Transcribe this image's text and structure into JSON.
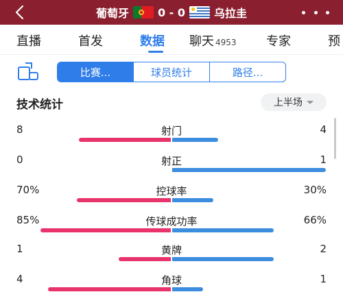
{
  "header": {
    "home_team": "葡萄牙",
    "away_team": "乌拉圭",
    "score": "0 - 0",
    "colors": {
      "header_bg": "#8a1f2f",
      "accent": "#2e7de9",
      "home_bar": "#e8336c",
      "away_bar": "#3d8ddf"
    }
  },
  "nav": {
    "tabs": [
      {
        "label": "直播"
      },
      {
        "label": "首发"
      },
      {
        "label": "数据"
      },
      {
        "label": "聊天",
        "count": "4953"
      },
      {
        "label": "专家"
      },
      {
        "label": "预"
      }
    ],
    "active": "数据"
  },
  "segments": {
    "items": [
      "比赛...",
      "球员统计",
      "路径..."
    ],
    "active": "比赛..."
  },
  "section": {
    "title": "技术统计",
    "period": "上半场"
  },
  "stats": [
    {
      "label": "射门",
      "home": "8",
      "away": "4",
      "home_frac": 0.6,
      "away_frac": 0.3
    },
    {
      "label": "射正",
      "home": "0",
      "away": "1",
      "home_frac": 0.0,
      "away_frac": 1.0
    },
    {
      "label": "控球率",
      "home": "70%",
      "away": "30%",
      "home_frac": 0.61,
      "away_frac": 0.27
    },
    {
      "label": "传球成功率",
      "home": "85%",
      "away": "66%",
      "home_frac": 0.85,
      "away_frac": 0.66
    },
    {
      "label": "黄牌",
      "home": "1",
      "away": "2",
      "home_frac": 0.34,
      "away_frac": 0.66
    },
    {
      "label": "角球",
      "home": "4",
      "away": "1",
      "home_frac": 0.8,
      "away_frac": 0.2
    }
  ]
}
